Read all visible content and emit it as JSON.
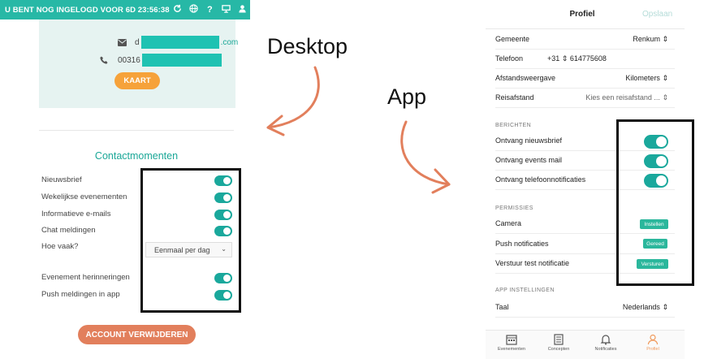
{
  "labels": {
    "desktop": "Desktop",
    "app": "App"
  },
  "desktop": {
    "topbar": {
      "message": "U BENT NOG INGELOGD VOOR 6D 23:56:38",
      "icons": [
        "refresh-icon",
        "globe-icon",
        "help-icon",
        "monitor-icon",
        "user-icon"
      ],
      "help_glyph": "?"
    },
    "contact": {
      "email_prefix": "d",
      "email_suffix": ".com",
      "phone_prefix": "00316",
      "map_button": "KAART"
    },
    "section_title": "Contactmomenten",
    "settings": [
      {
        "label": "Nieuwsbrief",
        "on": true
      },
      {
        "label": "Wekelijkse evenementen",
        "on": true
      },
      {
        "label": "Informatieve e-mails",
        "on": true
      },
      {
        "label": "Chat meldingen",
        "on": true
      }
    ],
    "frequency": {
      "label": "Hoe vaak?",
      "value": "Eenmaal per dag"
    },
    "settings2": [
      {
        "label": "Evenement herinneringen",
        "on": true
      },
      {
        "label": "Push meldingen in app",
        "on": true
      }
    ],
    "delete_button": "ACCOUNT VERWIJDEREN",
    "colors": {
      "accent": "#27b8a6",
      "toggle": "#1aa89c",
      "kaart": "#f6a23a",
      "delete": "#e27f5c"
    }
  },
  "app": {
    "header": {
      "title": "Profiel",
      "save": "Opslaan"
    },
    "rows": [
      {
        "label": "Gemeente",
        "value": "Renkum"
      },
      {
        "label": "Telefoon",
        "country": "+31",
        "value": "614775608"
      },
      {
        "label": "Afstandsweergave",
        "value": "Kilometers"
      },
      {
        "label": "Reisafstand",
        "value": "Kies een reisafstand ..."
      }
    ],
    "section_berichten": "BERICHTEN",
    "berichten": [
      {
        "label": "Ontvang nieuwsbrief",
        "on": true
      },
      {
        "label": "Ontvang events mail",
        "on": true
      },
      {
        "label": "Ontvang telefoonnotificaties",
        "on": true
      }
    ],
    "section_permissies": "PERMISSIES",
    "permissies": [
      {
        "label": "Camera",
        "action": "Instellen"
      },
      {
        "label": "Push notificaties",
        "action": "Gereed"
      },
      {
        "label": "Verstuur test notificatie",
        "action": "Versturen"
      }
    ],
    "section_app": "APP INSTELLINGEN",
    "language": {
      "label": "Taal",
      "value": "Nederlands"
    },
    "tabs": [
      {
        "label": "Evenementen",
        "icon": "calendar-icon"
      },
      {
        "label": "Concepten",
        "icon": "document-icon"
      },
      {
        "label": "Notificaties",
        "icon": "bell-icon"
      },
      {
        "label": "Profiel",
        "icon": "profile-icon",
        "active": true
      }
    ],
    "colors": {
      "toggle": "#1aa89c",
      "pill": "#2bb79c",
      "active_tab": "#f09a5c"
    }
  }
}
